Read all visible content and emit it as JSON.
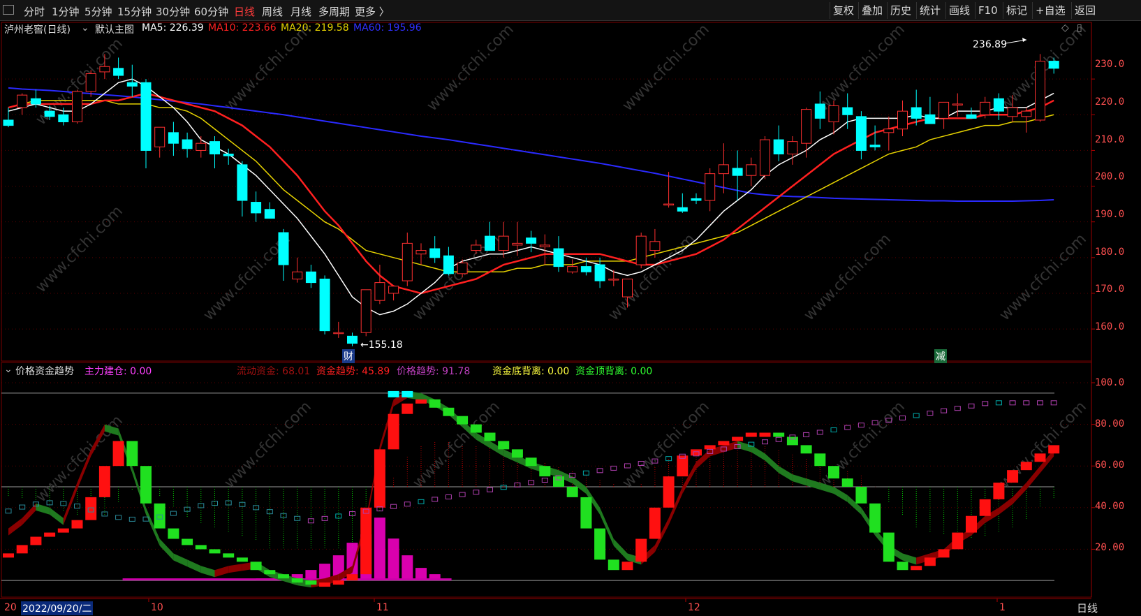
{
  "toolbar": {
    "timeframes": [
      "分时",
      "1分钟",
      "5分钟",
      "15分钟",
      "30分钟",
      "60分钟",
      "日线",
      "周线",
      "月线",
      "多周期",
      "更多 〉"
    ],
    "active": "日线",
    "right_buttons": [
      "复权",
      "叠加",
      "历史",
      "统计",
      "画线",
      "F10",
      "标记",
      "+自选",
      "返回"
    ]
  },
  "main_header": {
    "stock": "泸州老窖(日线)",
    "template": "默认主图",
    "ma5": "MA5: 226.39",
    "ma10": "MA10: 223.66",
    "ma20": "MA20: 219.58",
    "ma60": "MA60: 195.96"
  },
  "indicator_header": {
    "name": "价格资金趋势",
    "l1": "主力建仓: 0.00",
    "l2": "流动资金: 68.01",
    "l3": "资金趋势: 45.89",
    "l4": "价格趋势: 91.78",
    "l5": "资金底背离: 0.00",
    "l6": "资金顶背离: 0.00"
  },
  "price_axis": [
    "230.0",
    "220.0",
    "210.0",
    "200.0",
    "190.0",
    "180.0",
    "170.0",
    "160.0"
  ],
  "indicator_axis": [
    "100.0",
    "80.00",
    "60.00",
    "40.00",
    "20.00"
  ],
  "annotations": {
    "high": "236.89",
    "low": "←155.18",
    "tag1": "财",
    "tag2": "减"
  },
  "date_labels": [
    "20",
    "10",
    "11",
    "12",
    "1"
  ],
  "cursor_date": "2022/09/20/二",
  "period_label": "日线",
  "colors": {
    "up": "#ff3030",
    "down": "#00ffff",
    "ma5": "#ffffff",
    "ma10": "#ff2020",
    "ma20": "#e6d200",
    "ma60": "#2a2aff",
    "accent": "#ff3b3b"
  },
  "watermark": "www.cfchi.com",
  "chart_data": {
    "type": "candlestick",
    "ylim": [
      152,
      240
    ],
    "candles": [
      [
        218.5,
        222.0,
        216.5,
        217.0
      ],
      [
        222.0,
        226.0,
        220.0,
        225.5
      ],
      [
        224.5,
        227.0,
        222.0,
        223.0
      ],
      [
        221.0,
        222.5,
        218.5,
        219.5
      ],
      [
        220.0,
        222.0,
        217.0,
        218.0
      ],
      [
        218.0,
        227.0,
        217.5,
        226.5
      ],
      [
        226.5,
        232.5,
        225.0,
        231.5
      ],
      [
        232.0,
        237.0,
        230.0,
        233.5
      ],
      [
        233.0,
        236.0,
        230.0,
        231.0
      ],
      [
        229.0,
        234.0,
        225.0,
        228.0
      ],
      [
        229.0,
        230.0,
        205.0,
        210.0
      ],
      [
        211.0,
        216.0,
        208.0,
        216.5
      ],
      [
        215.0,
        218.0,
        208.5,
        212.0
      ],
      [
        213.0,
        215.0,
        208.0,
        210.5
      ],
      [
        210.0,
        214.0,
        208.0,
        212.0
      ],
      [
        212.5,
        214.0,
        205.0,
        209.0
      ],
      [
        209.0,
        210.5,
        206.0,
        208.5
      ],
      [
        206.0,
        207.0,
        191.5,
        196.0
      ],
      [
        195.5,
        198.5,
        190.0,
        192.5
      ],
      [
        193.5,
        195.5,
        191.5,
        191.0
      ],
      [
        187.0,
        188.0,
        173.5,
        178.0
      ],
      [
        174.0,
        180.0,
        173.0,
        176.0
      ],
      [
        176.0,
        178.0,
        171.5,
        173.0
      ],
      [
        174.0,
        175.0,
        158.5,
        159.5
      ],
      [
        159.0,
        162.0,
        157.5,
        159.0
      ],
      [
        158.0,
        159.0,
        155.2,
        156.0
      ],
      [
        159.0,
        171.0,
        158.0,
        171.0
      ],
      [
        168.0,
        178.0,
        167.0,
        173.0
      ],
      [
        170.0,
        172.0,
        168.0,
        172.0
      ],
      [
        173.5,
        187.0,
        172.0,
        184.0
      ],
      [
        181.0,
        184.0,
        178.0,
        182.0
      ],
      [
        182.5,
        186.0,
        178.5,
        180.0
      ],
      [
        180.5,
        183.0,
        175.0,
        175.5
      ],
      [
        175.5,
        179.5,
        174.5,
        178.5
      ],
      [
        182.0,
        185.0,
        181.0,
        183.5
      ],
      [
        186.0,
        190.0,
        183.0,
        182.0
      ],
      [
        182.0,
        190.0,
        180.0,
        186.0
      ],
      [
        183.5,
        190.0,
        180.5,
        184.0
      ],
      [
        185.5,
        187.5,
        181.5,
        184.0
      ],
      [
        183.0,
        186.5,
        178.0,
        183.5
      ],
      [
        182.5,
        186.0,
        176.0,
        177.5
      ],
      [
        176.0,
        179.5,
        175.5,
        177.5
      ],
      [
        177.5,
        180.0,
        175.0,
        176.0
      ],
      [
        178.0,
        180.0,
        171.5,
        173.5
      ],
      [
        174.0,
        176.5,
        172.0,
        174.0
      ],
      [
        169.0,
        173.0,
        166.0,
        174.0
      ],
      [
        178.0,
        187.0,
        177.0,
        186.0
      ],
      [
        182.0,
        188.0,
        180.0,
        184.5
      ],
      [
        195.0,
        204.0,
        194.0,
        195.0
      ],
      [
        194.0,
        198.0,
        192.5,
        193.0
      ],
      [
        196.5,
        198.0,
        195.0,
        196.0
      ],
      [
        196.0,
        205.0,
        193.0,
        203.5
      ],
      [
        203.5,
        212.0,
        198.0,
        206.0
      ],
      [
        205.0,
        210.0,
        196.0,
        203.0
      ],
      [
        203.0,
        208.0,
        200.0,
        206.0
      ],
      [
        203.0,
        214.0,
        202.0,
        213.0
      ],
      [
        213.0,
        217.0,
        207.0,
        209.0
      ],
      [
        209.0,
        214.0,
        206.0,
        212.5
      ],
      [
        212.0,
        222.0,
        208.0,
        221.5
      ],
      [
        223.0,
        226.5,
        216.0,
        219.0
      ],
      [
        218.0,
        224.0,
        214.5,
        222.5
      ],
      [
        222.0,
        226.0,
        216.0,
        220.0
      ],
      [
        219.5,
        221.0,
        207.5,
        210.0
      ],
      [
        211.5,
        217.0,
        210.0,
        211.0
      ],
      [
        215.0,
        219.5,
        210.0,
        216.0
      ],
      [
        216.0,
        224.0,
        214.0,
        221.0
      ],
      [
        222.0,
        227.0,
        217.0,
        219.0
      ],
      [
        220.0,
        225.0,
        218.0,
        217.5
      ],
      [
        219.0,
        223.0,
        216.0,
        223.5
      ],
      [
        223.0,
        226.0,
        219.5,
        223.0
      ],
      [
        220.0,
        222.0,
        219.0,
        219.0
      ],
      [
        220.0,
        225.0,
        219.0,
        223.5
      ],
      [
        224.5,
        226.0,
        218.5,
        221.0
      ],
      [
        219.5,
        225.5,
        218.0,
        222.0
      ],
      [
        219.5,
        222.0,
        215.0,
        221.0
      ],
      [
        218.5,
        237.0,
        218.0,
        235.0
      ],
      [
        235.0,
        236.0,
        231.5,
        233.0
      ]
    ],
    "ma5": [
      221,
      222,
      223,
      222,
      221,
      221,
      223,
      226,
      229,
      230,
      228,
      225,
      222,
      218,
      213,
      211,
      209,
      206,
      203,
      199,
      195,
      191,
      186,
      181,
      175,
      169,
      166,
      164,
      165,
      167,
      170,
      173,
      177,
      179,
      180,
      181,
      181,
      182,
      183,
      182,
      181,
      180,
      179,
      178,
      176,
      175,
      176,
      178,
      180,
      182,
      185,
      189,
      193,
      196,
      199,
      203,
      206,
      208,
      210,
      213,
      215,
      218,
      219,
      219,
      219,
      219,
      220,
      219,
      219,
      221,
      221,
      221,
      222,
      222,
      222,
      224,
      226
    ],
    "ma10": [
      222,
      223,
      223,
      223,
      223,
      223,
      223,
      224,
      224,
      225,
      226,
      225,
      224,
      223,
      222,
      221,
      219,
      217,
      214,
      211,
      207,
      203,
      198,
      193,
      189,
      184,
      179,
      175,
      172,
      171,
      170,
      171,
      172,
      173,
      174,
      176,
      178,
      179,
      180,
      181,
      181,
      181,
      181,
      181,
      180,
      179,
      178,
      178,
      179,
      180,
      181,
      183,
      185,
      188,
      191,
      194,
      197,
      200,
      203,
      206,
      209,
      211,
      213,
      215,
      216,
      217,
      218,
      219,
      219,
      219,
      219,
      220,
      220,
      220,
      221,
      222,
      224
    ],
    "ma20": [
      222,
      223,
      224,
      224,
      224,
      224,
      224,
      224,
      223,
      223,
      223,
      222,
      222,
      221,
      219,
      216,
      213,
      210,
      207,
      203,
      199,
      196,
      193,
      190,
      188,
      185,
      182,
      181,
      180,
      179,
      178,
      177,
      176,
      176,
      176,
      176,
      176,
      177,
      177,
      178,
      178,
      178,
      179,
      179,
      179,
      179,
      180,
      181,
      182,
      183,
      184,
      185,
      186,
      187,
      189,
      191,
      193,
      195,
      197,
      199,
      201,
      203,
      205,
      207,
      209,
      210,
      211,
      213,
      214,
      215,
      216,
      217,
      217,
      218,
      218,
      219,
      220
    ],
    "ma60": [
      227.5,
      227.2,
      227.0,
      226.8,
      226.5,
      226.2,
      225.9,
      225.6,
      225.3,
      225.0,
      224.6,
      224.2,
      223.8,
      223.4,
      223.0,
      222.5,
      222.0,
      221.5,
      221.0,
      220.5,
      220.0,
      219.4,
      218.8,
      218.2,
      217.6,
      217.0,
      216.4,
      215.8,
      215.2,
      214.6,
      214.0,
      213.5,
      213.0,
      212.4,
      211.8,
      211.2,
      210.6,
      210.0,
      209.4,
      208.8,
      208.2,
      207.6,
      207.0,
      206.4,
      205.7,
      205.0,
      204.3,
      203.6,
      202.8,
      202.0,
      201.2,
      200.4,
      199.6,
      198.8,
      198.0,
      197.6,
      197.3,
      197.1,
      197.0,
      196.8,
      196.6,
      196.5,
      196.4,
      196.3,
      196.2,
      196.1,
      196.0,
      195.9,
      195.9,
      195.8,
      195.8,
      195.8,
      195.8,
      195.8,
      195.9,
      196.0,
      196.2
    ],
    "indicator": {
      "ylim": [
        0,
        100
      ],
      "price_trend": [
        30,
        35,
        42,
        40,
        35,
        52,
        68,
        80,
        78,
        60,
        40,
        25,
        18,
        15,
        12,
        10,
        12,
        13,
        14,
        10,
        8,
        6,
        5,
        6,
        8,
        12,
        35,
        70,
        92,
        96,
        95,
        92,
        88,
        82,
        76,
        72,
        68,
        65,
        62,
        60,
        58,
        55,
        50,
        40,
        25,
        18,
        16,
        22,
        35,
        50,
        62,
        68,
        70,
        72,
        70,
        66,
        60,
        56,
        54,
        52,
        50,
        46,
        40,
        30,
        22,
        18,
        16,
        18,
        20,
        26,
        30,
        36,
        40,
        45,
        52,
        60,
        68
      ],
      "fund_trend": [
        18,
        22,
        26,
        28,
        30,
        34,
        45,
        60,
        72,
        60,
        42,
        30,
        25,
        22,
        20,
        18,
        16,
        14,
        10,
        8,
        6,
        5,
        4,
        4,
        5,
        8,
        40,
        68,
        85,
        90,
        92,
        88,
        84,
        80,
        76,
        72,
        68,
        64,
        60,
        55,
        50,
        45,
        30,
        15,
        10,
        14,
        25,
        40,
        55,
        65,
        68,
        70,
        72,
        74,
        76,
        76,
        74,
        70,
        66,
        60,
        54,
        50,
        42,
        28,
        14,
        10,
        12,
        16,
        20,
        28,
        36,
        44,
        52,
        58,
        62,
        66,
        70
      ],
      "bars": [
        45,
        44,
        42,
        40,
        38,
        36,
        35,
        36,
        42,
        48,
        52,
        45,
        40,
        35,
        32,
        30,
        28,
        26,
        24,
        20,
        18,
        16,
        14,
        12,
        11,
        10,
        25,
        38,
        55,
        65,
        70,
        72,
        72,
        70,
        70,
        69,
        68,
        66,
        64,
        62,
        60,
        58,
        56,
        54,
        52,
        50,
        52,
        60,
        64,
        65,
        66,
        67,
        68,
        69,
        70,
        70,
        68,
        66,
        64,
        62,
        60,
        58,
        56,
        50,
        42,
        36,
        30,
        28,
        27,
        26,
        25,
        26,
        28,
        30,
        34,
        40,
        44
      ]
    }
  }
}
